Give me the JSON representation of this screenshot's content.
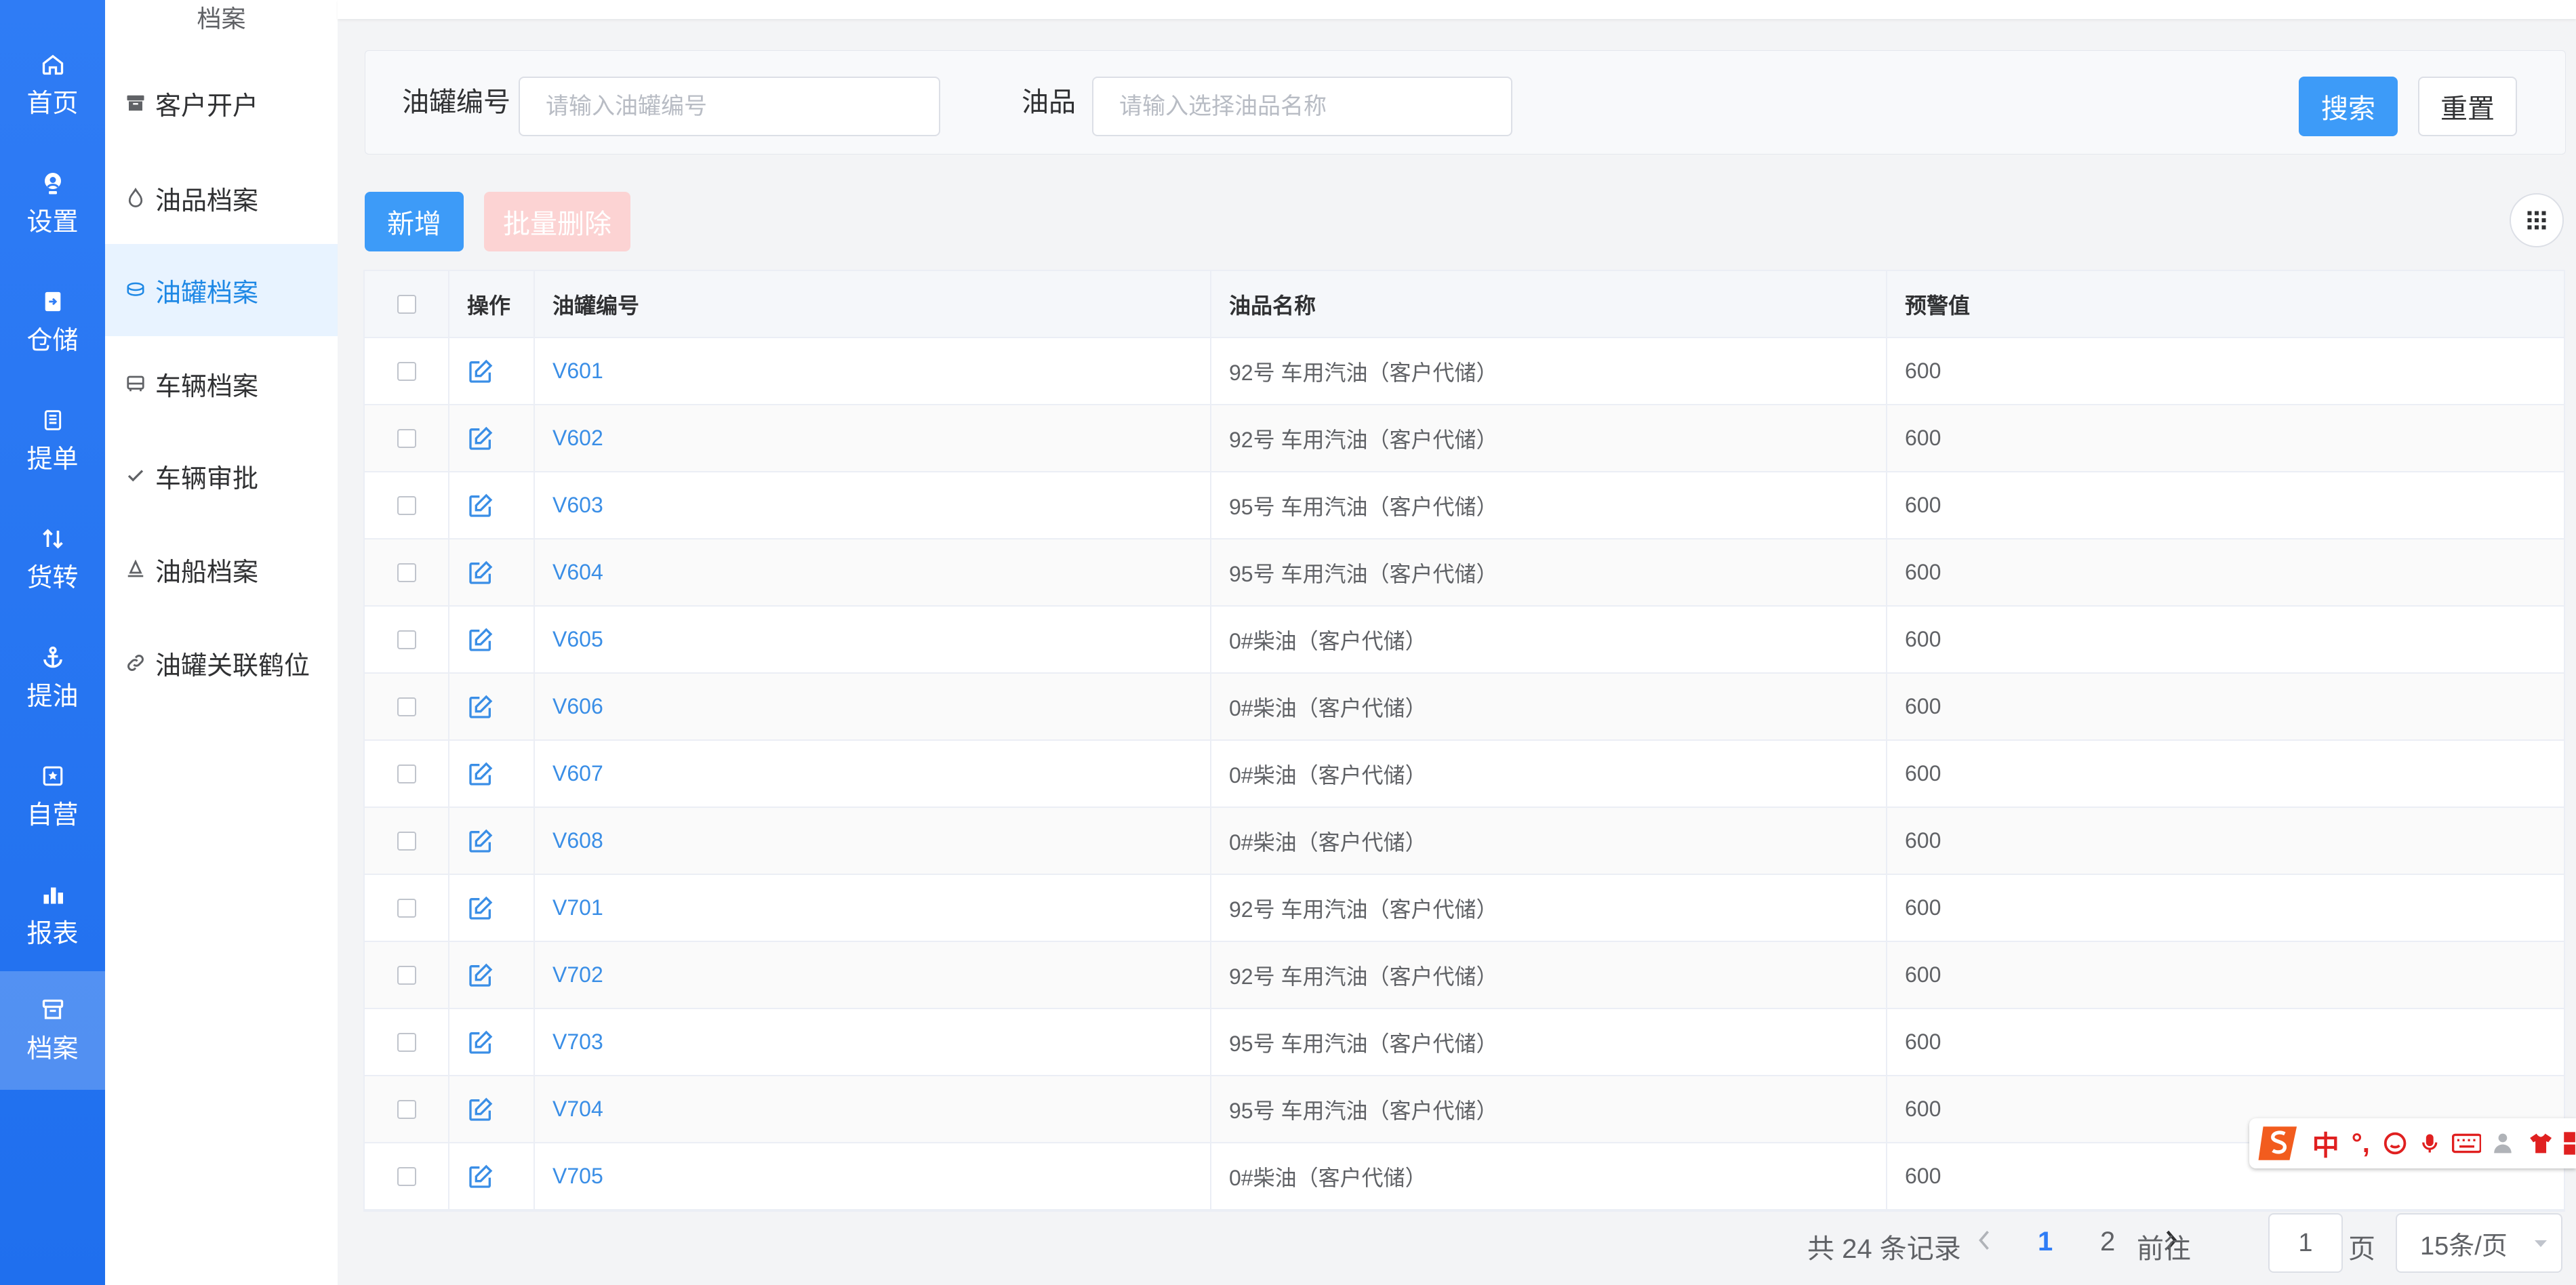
{
  "nav": [
    {
      "label": "首页",
      "icon": "home-icon"
    },
    {
      "label": "设置",
      "icon": "settings-user-icon"
    },
    {
      "label": "仓储",
      "icon": "storage-icon"
    },
    {
      "label": "提单",
      "icon": "document-icon"
    },
    {
      "label": "货转",
      "icon": "transfer-icon"
    },
    {
      "label": "提油",
      "icon": "anchor-icon"
    },
    {
      "label": "自营",
      "icon": "self-operated-icon"
    },
    {
      "label": "报表",
      "icon": "chart-icon"
    },
    {
      "label": "档案",
      "icon": "archive-icon"
    }
  ],
  "submenu": {
    "title": "档案",
    "items": [
      {
        "label": "客户开户",
        "icon": "box-icon"
      },
      {
        "label": "油品档案",
        "icon": "drop-icon"
      },
      {
        "label": "油罐档案",
        "icon": "tank-icon"
      },
      {
        "label": "车辆档案",
        "icon": "vehicle-icon"
      },
      {
        "label": "车辆审批",
        "icon": "check-icon"
      },
      {
        "label": "油船档案",
        "icon": "ship-icon"
      },
      {
        "label": "油罐关联鹤位",
        "icon": "link-icon"
      }
    ]
  },
  "search": {
    "tank_label": "油罐编号",
    "tank_placeholder": "请输入油罐编号",
    "oil_label": "油品",
    "oil_placeholder": "请输入选择油品名称",
    "search_btn": "搜索",
    "reset_btn": "重置"
  },
  "toolbar": {
    "add_btn": "新增",
    "batch_delete_btn": "批量删除"
  },
  "table": {
    "headers": {
      "op": "操作",
      "code": "油罐编号",
      "oil": "油品名称",
      "warn": "预警值"
    },
    "rows": [
      {
        "code": "V601",
        "oil": "92号 车用汽油（客户代储）",
        "warn": "600"
      },
      {
        "code": "V602",
        "oil": "92号 车用汽油（客户代储）",
        "warn": "600"
      },
      {
        "code": "V603",
        "oil": "95号 车用汽油（客户代储）",
        "warn": "600"
      },
      {
        "code": "V604",
        "oil": "95号 车用汽油（客户代储）",
        "warn": "600"
      },
      {
        "code": "V605",
        "oil": "0#柴油（客户代储）",
        "warn": "600"
      },
      {
        "code": "V606",
        "oil": "0#柴油（客户代储）",
        "warn": "600"
      },
      {
        "code": "V607",
        "oil": "0#柴油（客户代储）",
        "warn": "600"
      },
      {
        "code": "V608",
        "oil": "0#柴油（客户代储）",
        "warn": "600"
      },
      {
        "code": "V701",
        "oil": "92号 车用汽油（客户代储）",
        "warn": "600"
      },
      {
        "code": "V702",
        "oil": "92号 车用汽油（客户代储）",
        "warn": "600"
      },
      {
        "code": "V703",
        "oil": "95号 车用汽油（客户代储）",
        "warn": "600"
      },
      {
        "code": "V704",
        "oil": "95号 车用汽油（客户代储）",
        "warn": "600"
      },
      {
        "code": "V705",
        "oil": "0#柴油（客户代储）",
        "warn": "600"
      }
    ]
  },
  "pagination": {
    "total": "共 24 条记录",
    "page1": "1",
    "page2": "2",
    "goto": "前往",
    "goto_value": "1",
    "page_suffix": "页",
    "page_size": "15条/页"
  },
  "ime": {
    "mode": "中"
  },
  "colors": {
    "nav_bg": "#2f7cf5",
    "primary": "#3d9bf8",
    "link": "#3a8ee6",
    "danger_disabled": "#fcd3d3"
  }
}
